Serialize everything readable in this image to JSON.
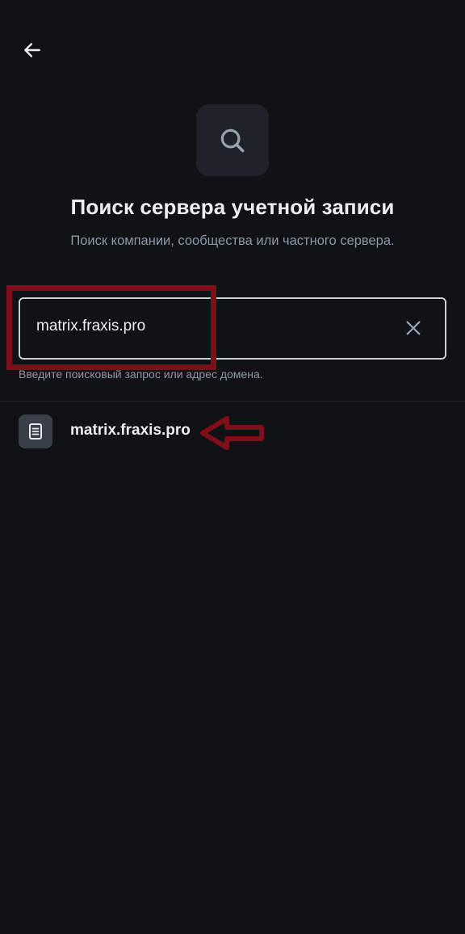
{
  "header": {
    "back_icon": "arrow-left-icon"
  },
  "hero": {
    "icon": "search-icon",
    "title": "Поиск сервера учетной записи",
    "subtitle": "Поиск компании, сообщества или частного сервера."
  },
  "search": {
    "value": "matrix.fraxis.pro",
    "clear_icon": "close-icon",
    "hint": "Введите поисковый запрос или адрес домена."
  },
  "results": [
    {
      "icon": "server-icon",
      "label": "matrix.fraxis.pro"
    }
  ],
  "annotations": {
    "color": "#7f0d1a",
    "highlight": "box around search field",
    "pointer": "arrow pointing left at result"
  },
  "colors": {
    "background": "#101216",
    "text_primary": "#ebeef2",
    "text_secondary": "#8d97a5",
    "tile": "#1f2229",
    "field_border": "#c8ccd3"
  }
}
